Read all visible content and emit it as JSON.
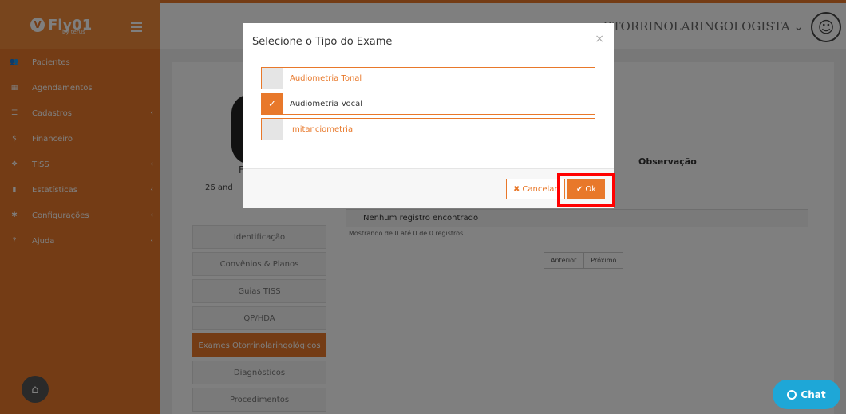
{
  "brand": {
    "name": "Fly01",
    "tagline": "by terus"
  },
  "sidebar": {
    "items": [
      {
        "label": "Pacientes",
        "icon": "users-icon",
        "glyph": "👥",
        "has_submenu": false
      },
      {
        "label": "Agendamentos",
        "icon": "calendar-icon",
        "glyph": "▦",
        "has_submenu": false
      },
      {
        "label": "Cadastros",
        "icon": "list-icon",
        "glyph": "☰",
        "has_submenu": true
      },
      {
        "label": "Financeiro",
        "icon": "dollar-icon",
        "glyph": "$",
        "has_submenu": false
      },
      {
        "label": "TISS",
        "icon": "tiss-icon",
        "glyph": "❖",
        "has_submenu": true
      },
      {
        "label": "Estatísticas",
        "icon": "chart-icon",
        "glyph": "▮",
        "has_submenu": true
      },
      {
        "label": "Configurações",
        "icon": "gear-icon",
        "glyph": "✱",
        "has_submenu": true
      },
      {
        "label": "Ajuda",
        "icon": "help-icon",
        "glyph": "?",
        "has_submenu": true
      }
    ],
    "submenu_glyph": "‹"
  },
  "header": {
    "role": "OTORRINOLARINGOLOGISTA",
    "role_caret": "⌄",
    "user_glyph": "☺"
  },
  "patient": {
    "name_visible": "F",
    "age_visible": "26 and"
  },
  "patient_tabs": [
    {
      "label": "Identificação",
      "active": false
    },
    {
      "label": "Convênios & Planos",
      "active": false
    },
    {
      "label": "Guias TISS",
      "active": false
    },
    {
      "label": "QP/HDA",
      "active": false
    },
    {
      "label": "Exames Otorrinolaringológicos",
      "active": true
    },
    {
      "label": "Diagnósticos",
      "active": false
    },
    {
      "label": "Procedimentos",
      "active": false
    }
  ],
  "table": {
    "column_observacao": "Observação",
    "empty_message": "Nenhum registro encontrado",
    "showing": "Mostrando de 0 até 0 de 0 registros",
    "pager": {
      "prev": "Anterior",
      "next": "Próximo"
    }
  },
  "modal": {
    "title": "Selecione o Tipo do Exame",
    "close": "×",
    "options": [
      {
        "label": "Audiometria Tonal",
        "checked": false
      },
      {
        "label": "Audiometria Vocal",
        "checked": true
      },
      {
        "label": "Imitanciometria",
        "checked": false
      }
    ],
    "check_glyph": "✓",
    "cancel": {
      "label": "Cancelar",
      "glyph": "✖"
    },
    "ok": {
      "label": "Ok",
      "glyph": "✔"
    }
  },
  "chat": {
    "label": "Chat",
    "support_glyph": "⌂"
  },
  "colors": {
    "accent": "#e8782a",
    "chat": "#1ea7d7",
    "highlight": "#ff0000"
  }
}
